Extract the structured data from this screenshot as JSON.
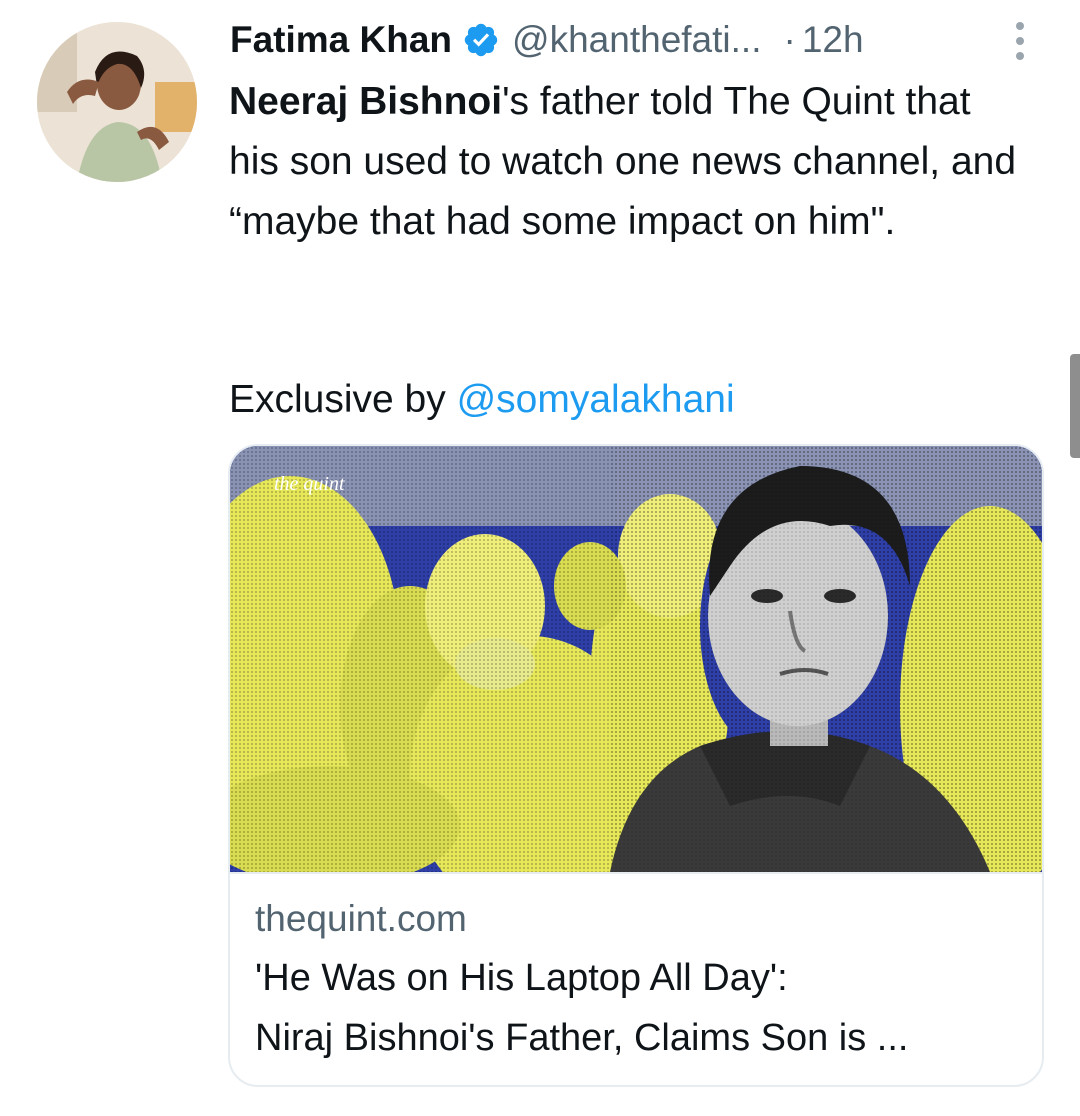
{
  "author": {
    "name": "Fatima Khan",
    "handle": "@khanthefati...",
    "separator": "·",
    "time": "12h",
    "verified": true
  },
  "tweet": {
    "bold_name": "Neeraj Bishnoi",
    "text_after_name": "'s father told The Quint that his son used to watch one news channel, and “maybe that had some impact on him\".",
    "exclusive_prefix": "Exclusive by ",
    "mention": "@somyalakhani"
  },
  "link_card": {
    "image_watermark": "the quint",
    "domain": "thequint.com",
    "title_line1": "'He Was on His Laptop All Day':",
    "title_line2": "Niraj Bishnoi's Father, Claims Son is ..."
  },
  "colors": {
    "accent": "#1d9bf0",
    "secondary_text": "#536471",
    "image_blue": "#2f3fa8",
    "image_yellow": "#e6e85a"
  },
  "icons": [
    "verified-badge-icon",
    "more-options-icon"
  ]
}
